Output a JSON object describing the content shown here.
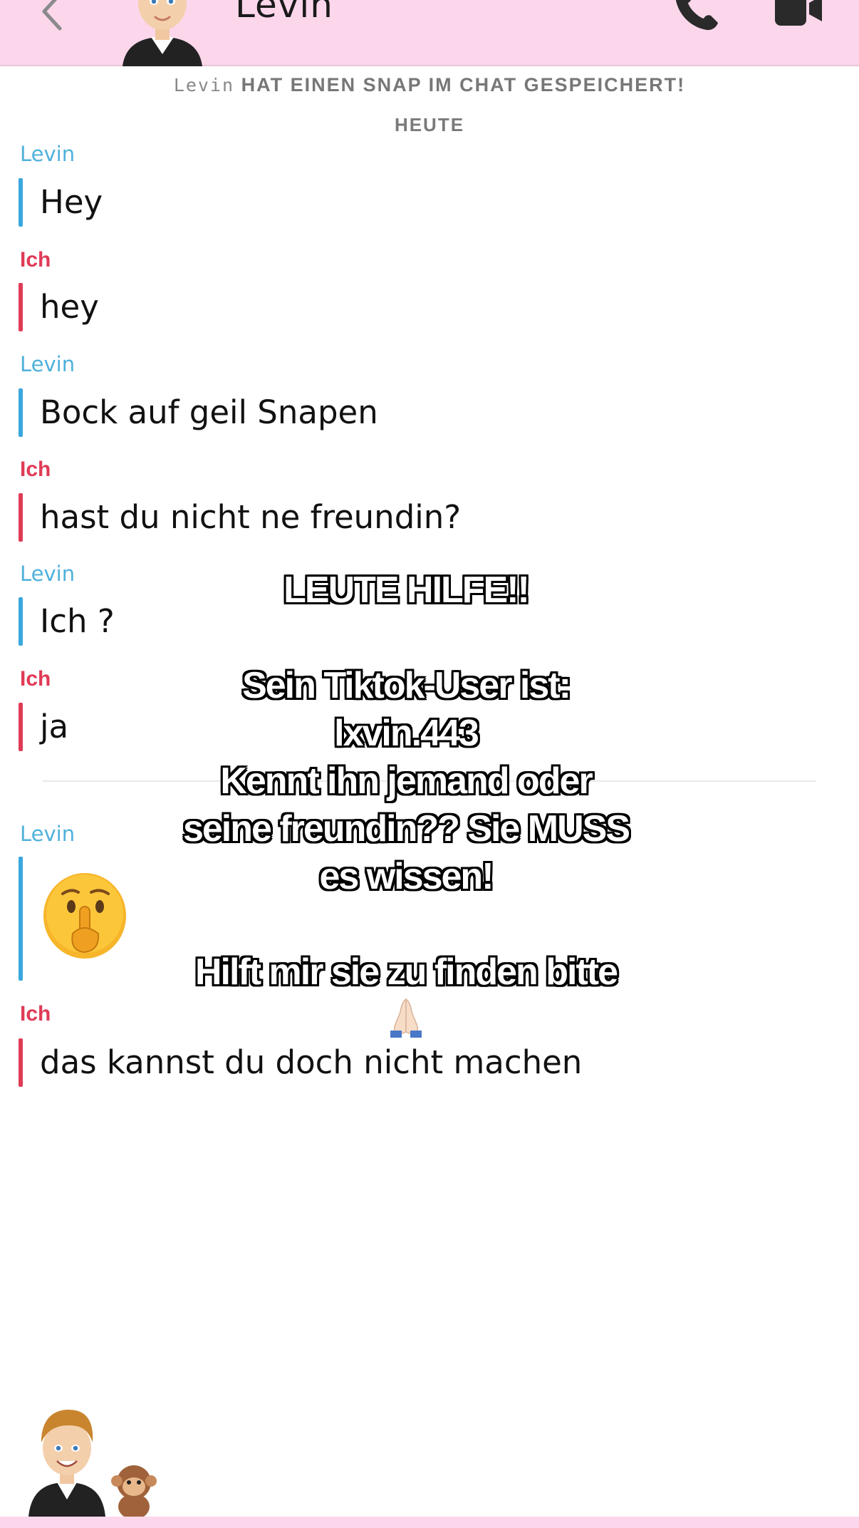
{
  "header": {
    "contact_name": "Levin",
    "back_icon": "chevron-left-icon",
    "call_icon": "phone-icon",
    "video_icon": "video-camera-icon",
    "background": "#fcd7ec"
  },
  "notice": {
    "name": "Levin",
    "text": "HAT EINEN SNAP IM CHAT GESPEICHERT!"
  },
  "date_separator": "HEUTE",
  "messages": [
    {
      "sender": "Levin",
      "text": "Hey"
    },
    {
      "sender": "Ich",
      "text": "hey"
    },
    {
      "sender": "Levin",
      "text": "Bock auf geil Snapen"
    },
    {
      "sender": "Ich",
      "text": "hast du nicht ne freundin?"
    },
    {
      "sender": "Levin",
      "text": "Ich ?"
    },
    {
      "sender": "Ich",
      "text": "ja"
    },
    {
      "sender": "Levin",
      "emoji": "shushing-face"
    },
    {
      "sender": "Ich",
      "text": "das kannst du doch nicht machen"
    }
  ],
  "colors": {
    "levin": "#3aa7dd",
    "me": "#e03b57"
  },
  "overlay": {
    "line1": "LEUTE HILFE!!",
    "line2": "Sein Tiktok-User ist:",
    "line3": "lxvin.443",
    "line4": "Kennt ihn jemand oder",
    "line5": "seine freundin?? Sie MUSS",
    "line6": "es wissen!",
    "line7": "Hilft mir sie zu finden bitte",
    "line7_emoji": "folded-hands"
  }
}
